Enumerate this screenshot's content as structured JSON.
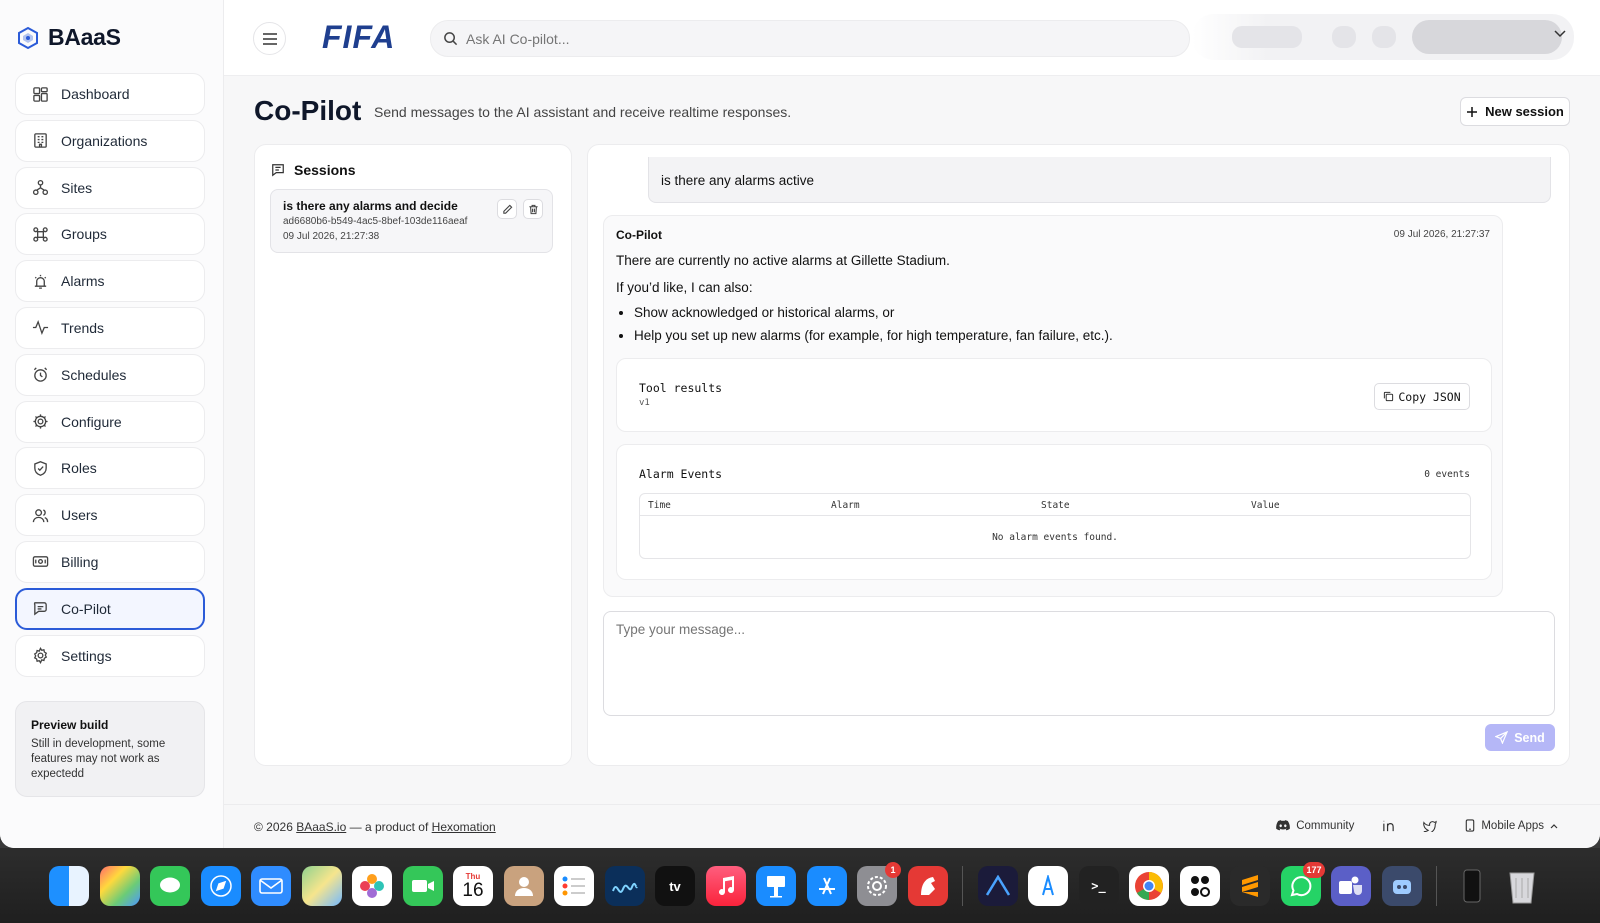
{
  "brand": {
    "name": "BAaaS"
  },
  "nav": [
    {
      "label": "Dashboard",
      "icon": "dashboard-icon"
    },
    {
      "label": "Organizations",
      "icon": "building-icon"
    },
    {
      "label": "Sites",
      "icon": "sites-icon"
    },
    {
      "label": "Groups",
      "icon": "command-icon"
    },
    {
      "label": "Alarms",
      "icon": "alarm-icon"
    },
    {
      "label": "Trends",
      "icon": "trend-icon"
    },
    {
      "label": "Schedules",
      "icon": "clock-icon"
    },
    {
      "label": "Configure",
      "icon": "gear-icon"
    },
    {
      "label": "Roles",
      "icon": "shield-icon"
    },
    {
      "label": "Users",
      "icon": "users-icon"
    },
    {
      "label": "Billing",
      "icon": "billing-icon"
    },
    {
      "label": "Co-Pilot",
      "icon": "copilot-icon",
      "active": true
    },
    {
      "label": "Settings",
      "icon": "settings-icon"
    }
  ],
  "preview": {
    "title": "Preview build",
    "desc": "Still in development, some features may not work as expectedd"
  },
  "topbar": {
    "org_logo": "FIFA",
    "search_placeholder": "Ask AI Co-pilot..."
  },
  "header": {
    "title": "Co-Pilot",
    "subtitle": "Send messages to the AI assistant and receive realtime responses.",
    "new_session": "New session"
  },
  "sessions": {
    "title": "Sessions",
    "items": [
      {
        "title": "is there any alarms and decide",
        "id": "ad6680b6-b549-4ac5-8bef-103de116aeaf",
        "date": "09 Jul 2026, 21:27:38"
      }
    ]
  },
  "chat": {
    "user_message": "is there any alarms active",
    "assistant": {
      "name": "Co-Pilot",
      "time": "09 Jul 2026, 21:27:37",
      "p1": "There are currently no active alarms at Gillette Stadium.",
      "p2": "If you’d like, I can also:",
      "bullets": [
        "Show acknowledged or historical alarms, or",
        "Help you set up new alarms (for example, for high temperature, fan failure, etc.)."
      ],
      "tool": {
        "title": "Tool results",
        "version": "v1",
        "copy_label": "Copy JSON"
      },
      "alarm_events": {
        "title": "Alarm Events",
        "count": "0 events",
        "columns": [
          "Time",
          "Alarm",
          "State",
          "Value"
        ],
        "empty": "No alarm events found."
      }
    },
    "composer_placeholder": "Type your message...",
    "send_label": "Send"
  },
  "footer": {
    "copyright": "© 2026",
    "site_link": "BAaaS.io",
    "mid": "— a product of",
    "company_link": "Hexomation",
    "community": "Community",
    "mobile_apps": "Mobile Apps"
  },
  "dock": {
    "calendar_month": "Thu",
    "calendar_day": "16",
    "settings_badge": "1",
    "whatsapp_badge": "177"
  },
  "colors": {
    "accent": "#2b5bd8",
    "send": "#b5b7f7",
    "fifa": "#1f3f8f"
  }
}
